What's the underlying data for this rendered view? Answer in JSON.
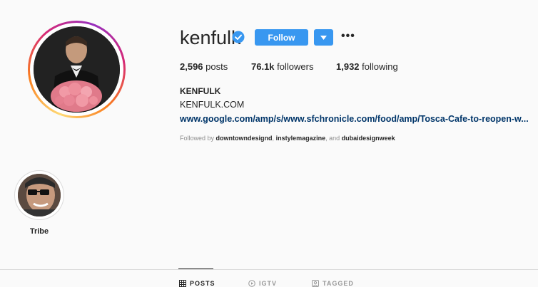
{
  "profile": {
    "username": "kenfulk",
    "follow_label": "Follow",
    "posts_count": "2,596",
    "posts_label": "posts",
    "followers_count": "76.1k",
    "followers_label": "followers",
    "following_count": "1,932",
    "following_label": "following",
    "full_name": "KENFULK",
    "bio": "KENFULK.COM",
    "link": "www.google.com/amp/s/www.sfchronicle.com/food/amp/Tosca-Cafe-to-reopen-w...",
    "followed_by_prefix": "Followed by",
    "followed_by": [
      "downtowndesignd",
      "instylemagazine",
      "dubaidesignweek"
    ],
    "followed_by_sep": ",",
    "followed_by_and": ", and"
  },
  "highlights": [
    {
      "label": "Tribe"
    }
  ],
  "tabs": [
    {
      "label": "POSTS",
      "icon": "grid-icon",
      "active": true
    },
    {
      "label": "IGTV",
      "icon": "igtv-icon",
      "active": false
    },
    {
      "label": "TAGGED",
      "icon": "tag-icon",
      "active": false
    }
  ],
  "colors": {
    "accent": "#3897f0",
    "link": "#003569",
    "text": "#262626",
    "muted": "#8e8e8e",
    "background": "#fafafa"
  }
}
